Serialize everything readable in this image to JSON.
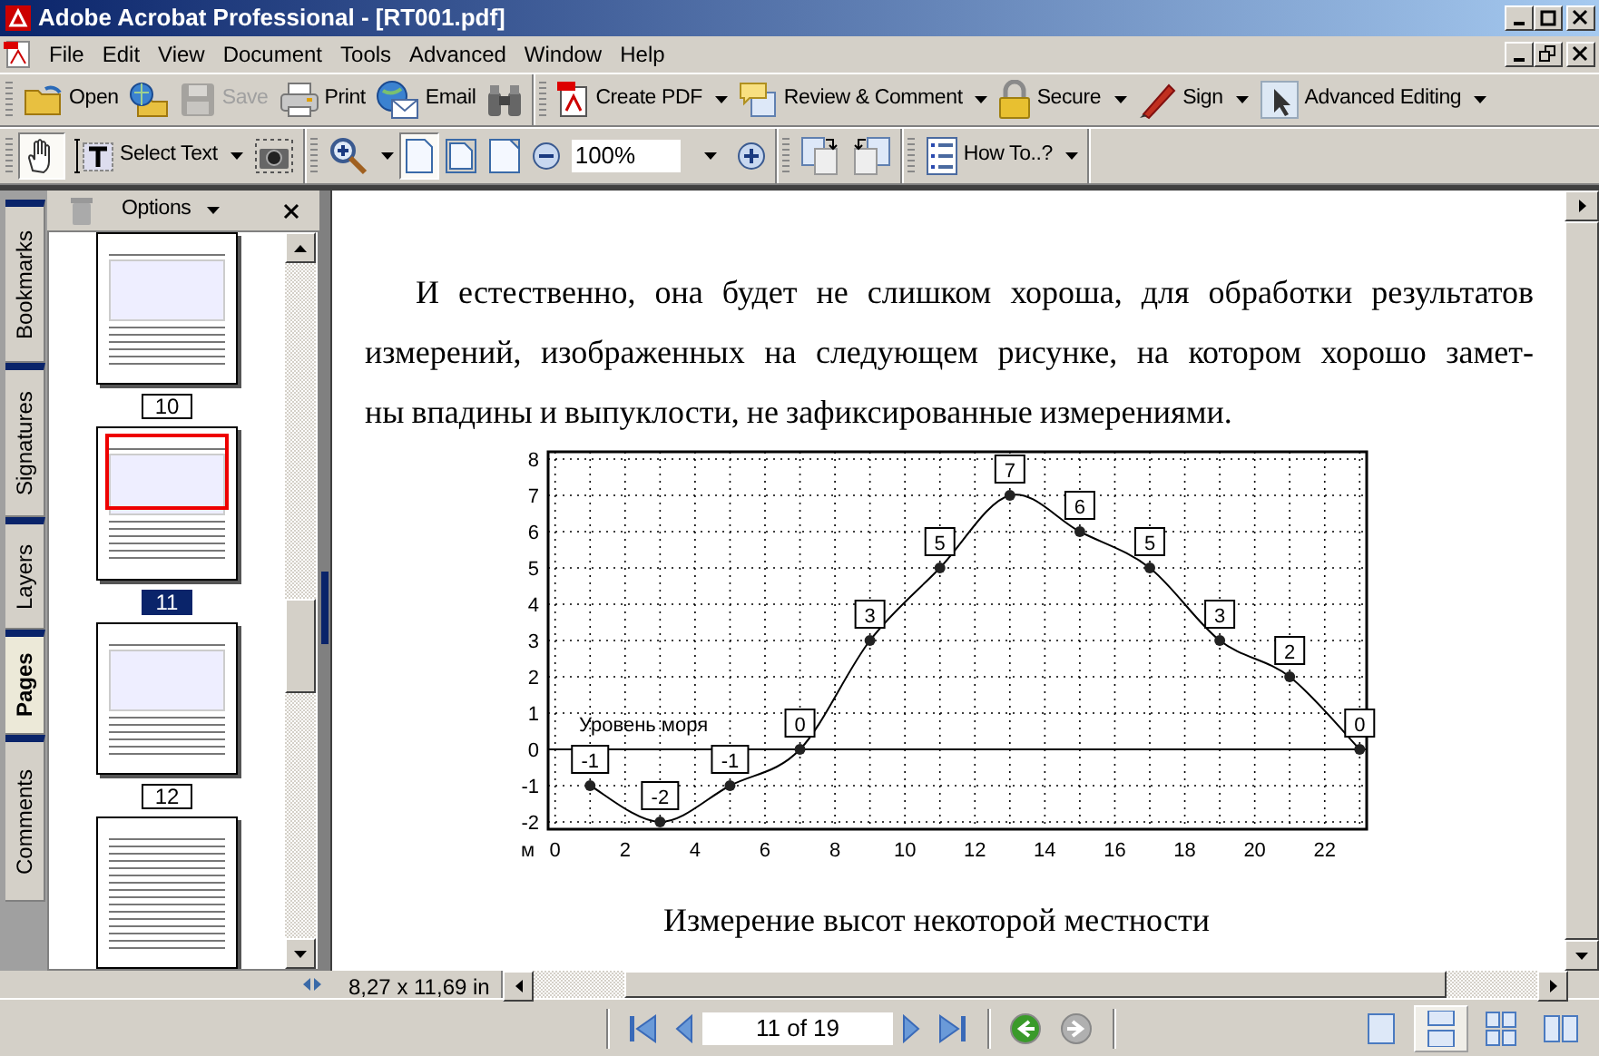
{
  "window": {
    "title": "Adobe Acrobat Professional - [RT001.pdf]"
  },
  "menu": [
    "File",
    "Edit",
    "View",
    "Document",
    "Tools",
    "Advanced",
    "Window",
    "Help"
  ],
  "toolbars": [
    {
      "groups": [
        {
          "items": [
            {
              "kind": "button",
              "label": "Open",
              "dropdown": false,
              "disabled": false,
              "pressed": false
            },
            {
              "kind": "button",
              "dropdown": false,
              "disabled": false,
              "pressed": false
            },
            {
              "kind": "button",
              "label": "Save",
              "dropdown": false,
              "disabled": true,
              "pressed": false
            },
            {
              "kind": "button",
              "label": "Print",
              "dropdown": false,
              "disabled": false,
              "pressed": false
            },
            {
              "kind": "button",
              "label": "Email",
              "dropdown": false,
              "disabled": false,
              "pressed": false
            },
            {
              "kind": "button",
              "dropdown": false,
              "disabled": false,
              "pressed": false
            }
          ]
        },
        {
          "items": [
            {
              "kind": "button",
              "label": "Create PDF",
              "dropdown": true,
              "disabled": false,
              "pressed": false
            },
            {
              "kind": "button",
              "label": "Review & Comment",
              "dropdown": true,
              "disabled": false,
              "pressed": false
            },
            {
              "kind": "button",
              "label": "Secure",
              "dropdown": true,
              "disabled": false,
              "pressed": false
            },
            {
              "kind": "button",
              "label": "Sign",
              "dropdown": true,
              "disabled": false,
              "pressed": false
            },
            {
              "kind": "button",
              "label": "Advanced Editing",
              "dropdown": true,
              "disabled": false,
              "pressed": false
            }
          ]
        }
      ]
    },
    {
      "groups": [
        {
          "items": [
            {
              "kind": "button",
              "dropdown": false,
              "disabled": false,
              "pressed": true
            },
            {
              "kind": "button",
              "label": "Select Text",
              "dropdown": true,
              "disabled": false,
              "pressed": false
            },
            {
              "kind": "button",
              "dropdown": false,
              "disabled": false,
              "pressed": false
            }
          ]
        },
        {
          "items": [
            {
              "kind": "button",
              "dropdown": true,
              "disabled": false,
              "pressed": false
            },
            {
              "kind": "button",
              "dropdown": false,
              "disabled": false,
              "pressed": true
            },
            {
              "kind": "button",
              "dropdown": false,
              "disabled": false,
              "pressed": false
            },
            {
              "kind": "button",
              "dropdown": false,
              "disabled": false,
              "pressed": false
            },
            {
              "kind": "button",
              "dropdown": false,
              "disabled": false,
              "pressed": false
            },
            {
              "kind": "field",
              "value": "100%",
              "dropdown": true
            },
            {
              "kind": "button",
              "dropdown": false,
              "disabled": false,
              "pressed": false
            }
          ]
        },
        {
          "items": [
            {
              "kind": "button",
              "dropdown": false,
              "disabled": false,
              "pressed": false
            },
            {
              "kind": "button",
              "dropdown": false,
              "disabled": false,
              "pressed": false
            }
          ]
        },
        {
          "items": [
            {
              "kind": "button",
              "label": "How To..?",
              "dropdown": true,
              "disabled": false,
              "pressed": false
            }
          ]
        }
      ]
    }
  ],
  "side_tabs": [
    {
      "label": "Bookmarks",
      "selected": false
    },
    {
      "label": "Signatures",
      "selected": false
    },
    {
      "label": "Layers",
      "selected": false
    },
    {
      "label": "Pages",
      "selected": true
    },
    {
      "label": "Comments",
      "selected": false
    }
  ],
  "pages_panel": {
    "options": "Options",
    "thumbnails": [
      {
        "page": "10",
        "selected": false
      },
      {
        "page": "11",
        "selected": true
      },
      {
        "page": "12",
        "selected": false
      }
    ]
  },
  "document": {
    "lines": [
      "И естественно, она будет не слишком хороша, для обработки результатов",
      "измерений, изображенных на следующем рисунке, на котором хорошо замет-",
      "ны впадины и выпуклости, не зафиксированные измерениями."
    ],
    "figure": {
      "chart_data": {
        "type": "line",
        "xlabel": "м",
        "x": [
          1,
          3,
          5,
          7,
          9,
          11,
          13,
          15,
          17,
          19,
          21,
          23
        ],
        "series": [
          {
            "color": "#000000",
            "marker": "circle",
            "values": [
              -1,
              -2,
              -1,
              0,
              3,
              5,
              7,
              6,
              5,
              3,
              2,
              0
            ]
          }
        ],
        "grid": true,
        "xlim": [
          -0.2,
          23.2
        ],
        "ylim": [
          -2.2,
          8.2
        ],
        "xticks": [
          0,
          2,
          4,
          6,
          8,
          10,
          12,
          14,
          16,
          18,
          20,
          22
        ],
        "yticks": [
          -2,
          -1,
          0,
          1,
          2,
          3,
          4,
          5,
          6,
          7,
          8
        ],
        "data_labels": true,
        "annotations": [
          "Уровень моря"
        ]
      },
      "caption": "Измерение высот некоторой местности"
    }
  },
  "page_size": "8,27 x 11,69 in",
  "navigation": {
    "page_field": "11 of 19",
    "history": [
      {
        "disabled": false
      },
      {
        "disabled": true
      }
    ]
  },
  "view_modes": [
    {
      "selected": false
    },
    {
      "selected": true
    },
    {
      "selected": false
    },
    {
      "selected": false
    }
  ]
}
